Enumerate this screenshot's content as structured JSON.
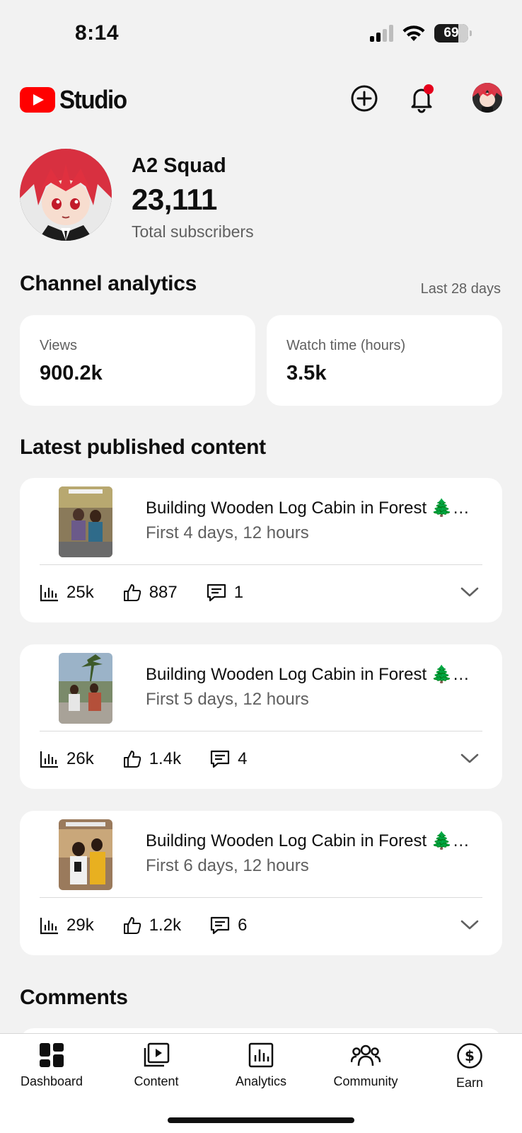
{
  "status_bar": {
    "time": "8:14",
    "battery": "69"
  },
  "header": {
    "logo_text": "Studio",
    "icons": [
      "create-icon",
      "notifications-icon",
      "account-avatar"
    ],
    "colors": {
      "brand_red": "#ff0000",
      "notification_dot": "#e5001c"
    }
  },
  "channel": {
    "name": "A2 Squad",
    "subscribers": "23,111",
    "subscribers_label": "Total subscribers"
  },
  "analytics": {
    "title": "Channel analytics",
    "range": "Last 28 days",
    "metrics": [
      {
        "label": "Views",
        "value": "900.2k"
      },
      {
        "label": "Watch time (hours)",
        "value": "3.5k"
      }
    ]
  },
  "latest": {
    "title": "Latest published content",
    "videos": [
      {
        "title": "Building Wooden Log Cabin in Forest 🌲…",
        "period": "First 4 days, 12 hours",
        "views": "25k",
        "likes": "887",
        "comments": "1"
      },
      {
        "title": "Building Wooden Log Cabin in Forest 🌲…",
        "period": "First 5 days, 12 hours",
        "views": "26k",
        "likes": "1.4k",
        "comments": "4"
      },
      {
        "title": "Building Wooden Log Cabin in Forest 🌲…",
        "period": "First 6 days, 12 hours",
        "views": "29k",
        "likes": "1.2k",
        "comments": "6"
      }
    ]
  },
  "comments": {
    "title": "Comments"
  },
  "nav": {
    "items": [
      {
        "label": "Dashboard",
        "icon": "dashboard-icon"
      },
      {
        "label": "Content",
        "icon": "content-icon"
      },
      {
        "label": "Analytics",
        "icon": "analytics-icon"
      },
      {
        "label": "Community",
        "icon": "community-icon"
      },
      {
        "label": "Earn",
        "icon": "earn-icon"
      }
    ]
  }
}
